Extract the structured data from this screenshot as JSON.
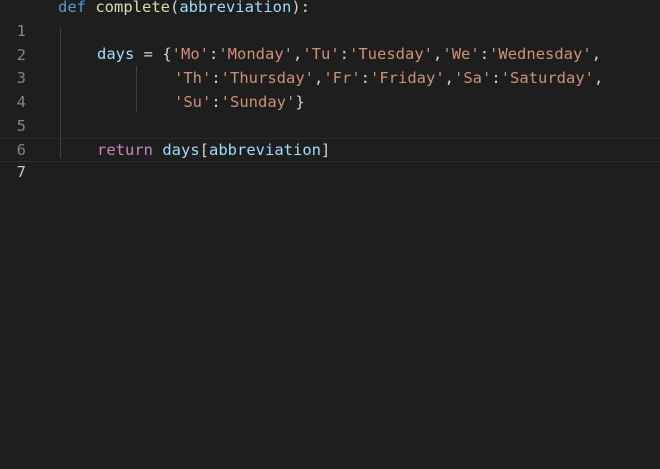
{
  "editor": {
    "lines": [
      {
        "number": "1"
      },
      {
        "number": "2"
      },
      {
        "number": "3"
      },
      {
        "number": "4"
      },
      {
        "number": "5"
      },
      {
        "number": "6"
      },
      {
        "number": "7"
      }
    ],
    "code": {
      "l1": {
        "def": "def",
        "name": "complete",
        "open": "(",
        "param": "abbreviation",
        "close": "):"
      },
      "l3": {
        "var": "days",
        "eq": " = ",
        "brace": "{",
        "k1": "'Mo'",
        "c1": ":",
        "v1": "'Monday'",
        "s1": ",",
        "k2": "'Tu'",
        "c2": ":",
        "v2": "'Tuesday'",
        "s2": ",",
        "k3": "'We'",
        "c3": ":",
        "v3": "'Wednesday'",
        "s3": ","
      },
      "l4": {
        "k1": "'Th'",
        "c1": ":",
        "v1": "'Thursday'",
        "s1": ",",
        "k2": "'Fr'",
        "c2": ":",
        "v2": "'Friday'",
        "s2": ",",
        "k3": "'Sa'",
        "c3": ":",
        "v3": "'Saturday'",
        "s3": ","
      },
      "l5": {
        "k1": "'Su'",
        "c1": ":",
        "v1": "'Sunday'",
        "brace": "}"
      },
      "l7": {
        "ret": "return",
        "var": "days",
        "open": "[",
        "param": "abbreviation",
        "close": "]"
      }
    }
  }
}
